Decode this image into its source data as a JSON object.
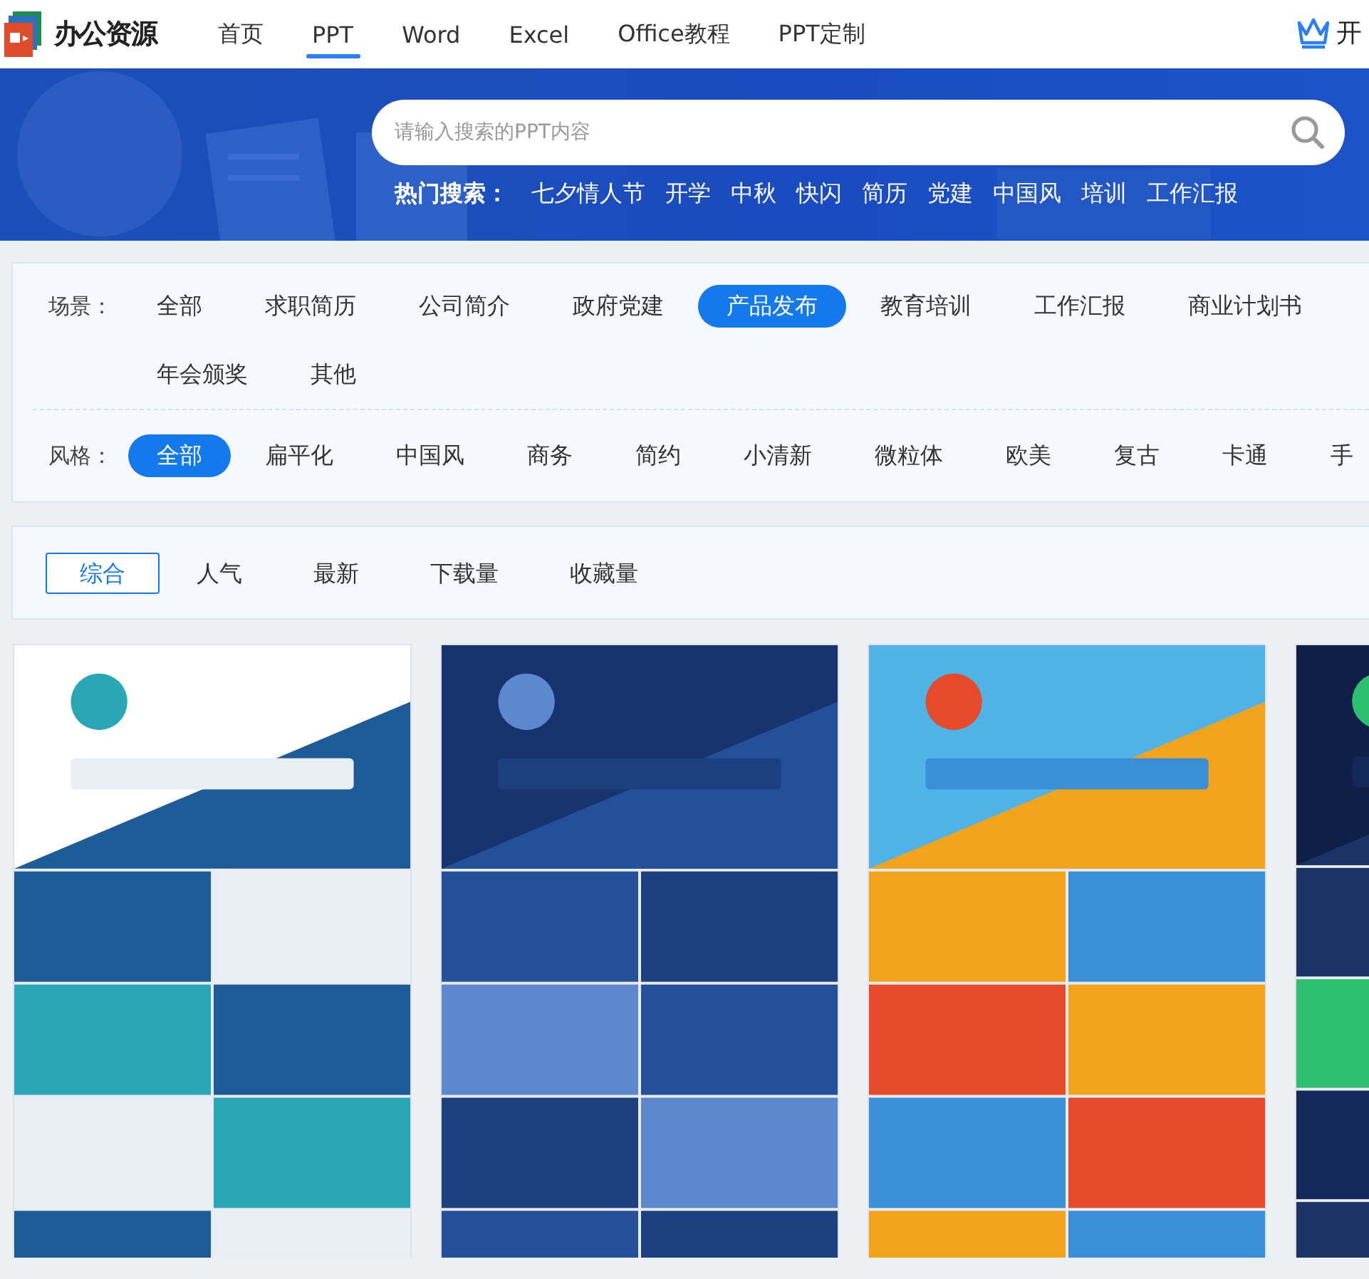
{
  "logo": {
    "text": "办公资源"
  },
  "nav": [
    {
      "label": "首页",
      "selected": false
    },
    {
      "label": "PPT",
      "selected": true
    },
    {
      "label": "Word",
      "selected": false
    },
    {
      "label": "Excel",
      "selected": false
    },
    {
      "label": "Office教程",
      "selected": false
    },
    {
      "label": "PPT定制",
      "selected": false
    }
  ],
  "vip": {
    "label": "开"
  },
  "search": {
    "placeholder": "请输入搜索的PPT内容"
  },
  "hot_searches": {
    "label": "热门搜索：",
    "items": [
      "七夕情人节",
      "开学",
      "中秋",
      "快闪",
      "简历",
      "党建",
      "中国风",
      "培训",
      "工作汇报"
    ]
  },
  "filters": [
    {
      "label": "场景：",
      "options": [
        {
          "label": "全部",
          "selected": false
        },
        {
          "label": "求职简历",
          "selected": false
        },
        {
          "label": "公司简介",
          "selected": false
        },
        {
          "label": "政府党建",
          "selected": false
        },
        {
          "label": "产品发布",
          "selected": true
        },
        {
          "label": "教育培训",
          "selected": false
        },
        {
          "label": "工作汇报",
          "selected": false
        },
        {
          "label": "商业计划书",
          "selected": false
        },
        {
          "label": "年会颁奖",
          "selected": false
        },
        {
          "label": "其他",
          "selected": false
        }
      ]
    },
    {
      "label": "风格：",
      "options": [
        {
          "label": "全部",
          "selected": true
        },
        {
          "label": "扁平化",
          "selected": false
        },
        {
          "label": "中国风",
          "selected": false
        },
        {
          "label": "商务",
          "selected": false
        },
        {
          "label": "简约",
          "selected": false
        },
        {
          "label": "小清新",
          "selected": false
        },
        {
          "label": "微粒体",
          "selected": false
        },
        {
          "label": "欧美",
          "selected": false
        },
        {
          "label": "复古",
          "selected": false
        },
        {
          "label": "卡通",
          "selected": false
        },
        {
          "label": "手",
          "selected": false
        }
      ]
    }
  ],
  "sort_tabs": [
    {
      "label": "综合",
      "selected": true
    },
    {
      "label": "人气",
      "selected": false
    },
    {
      "label": "最新",
      "selected": false
    },
    {
      "label": "下载量",
      "selected": false
    },
    {
      "label": "收藏量",
      "selected": false
    }
  ]
}
